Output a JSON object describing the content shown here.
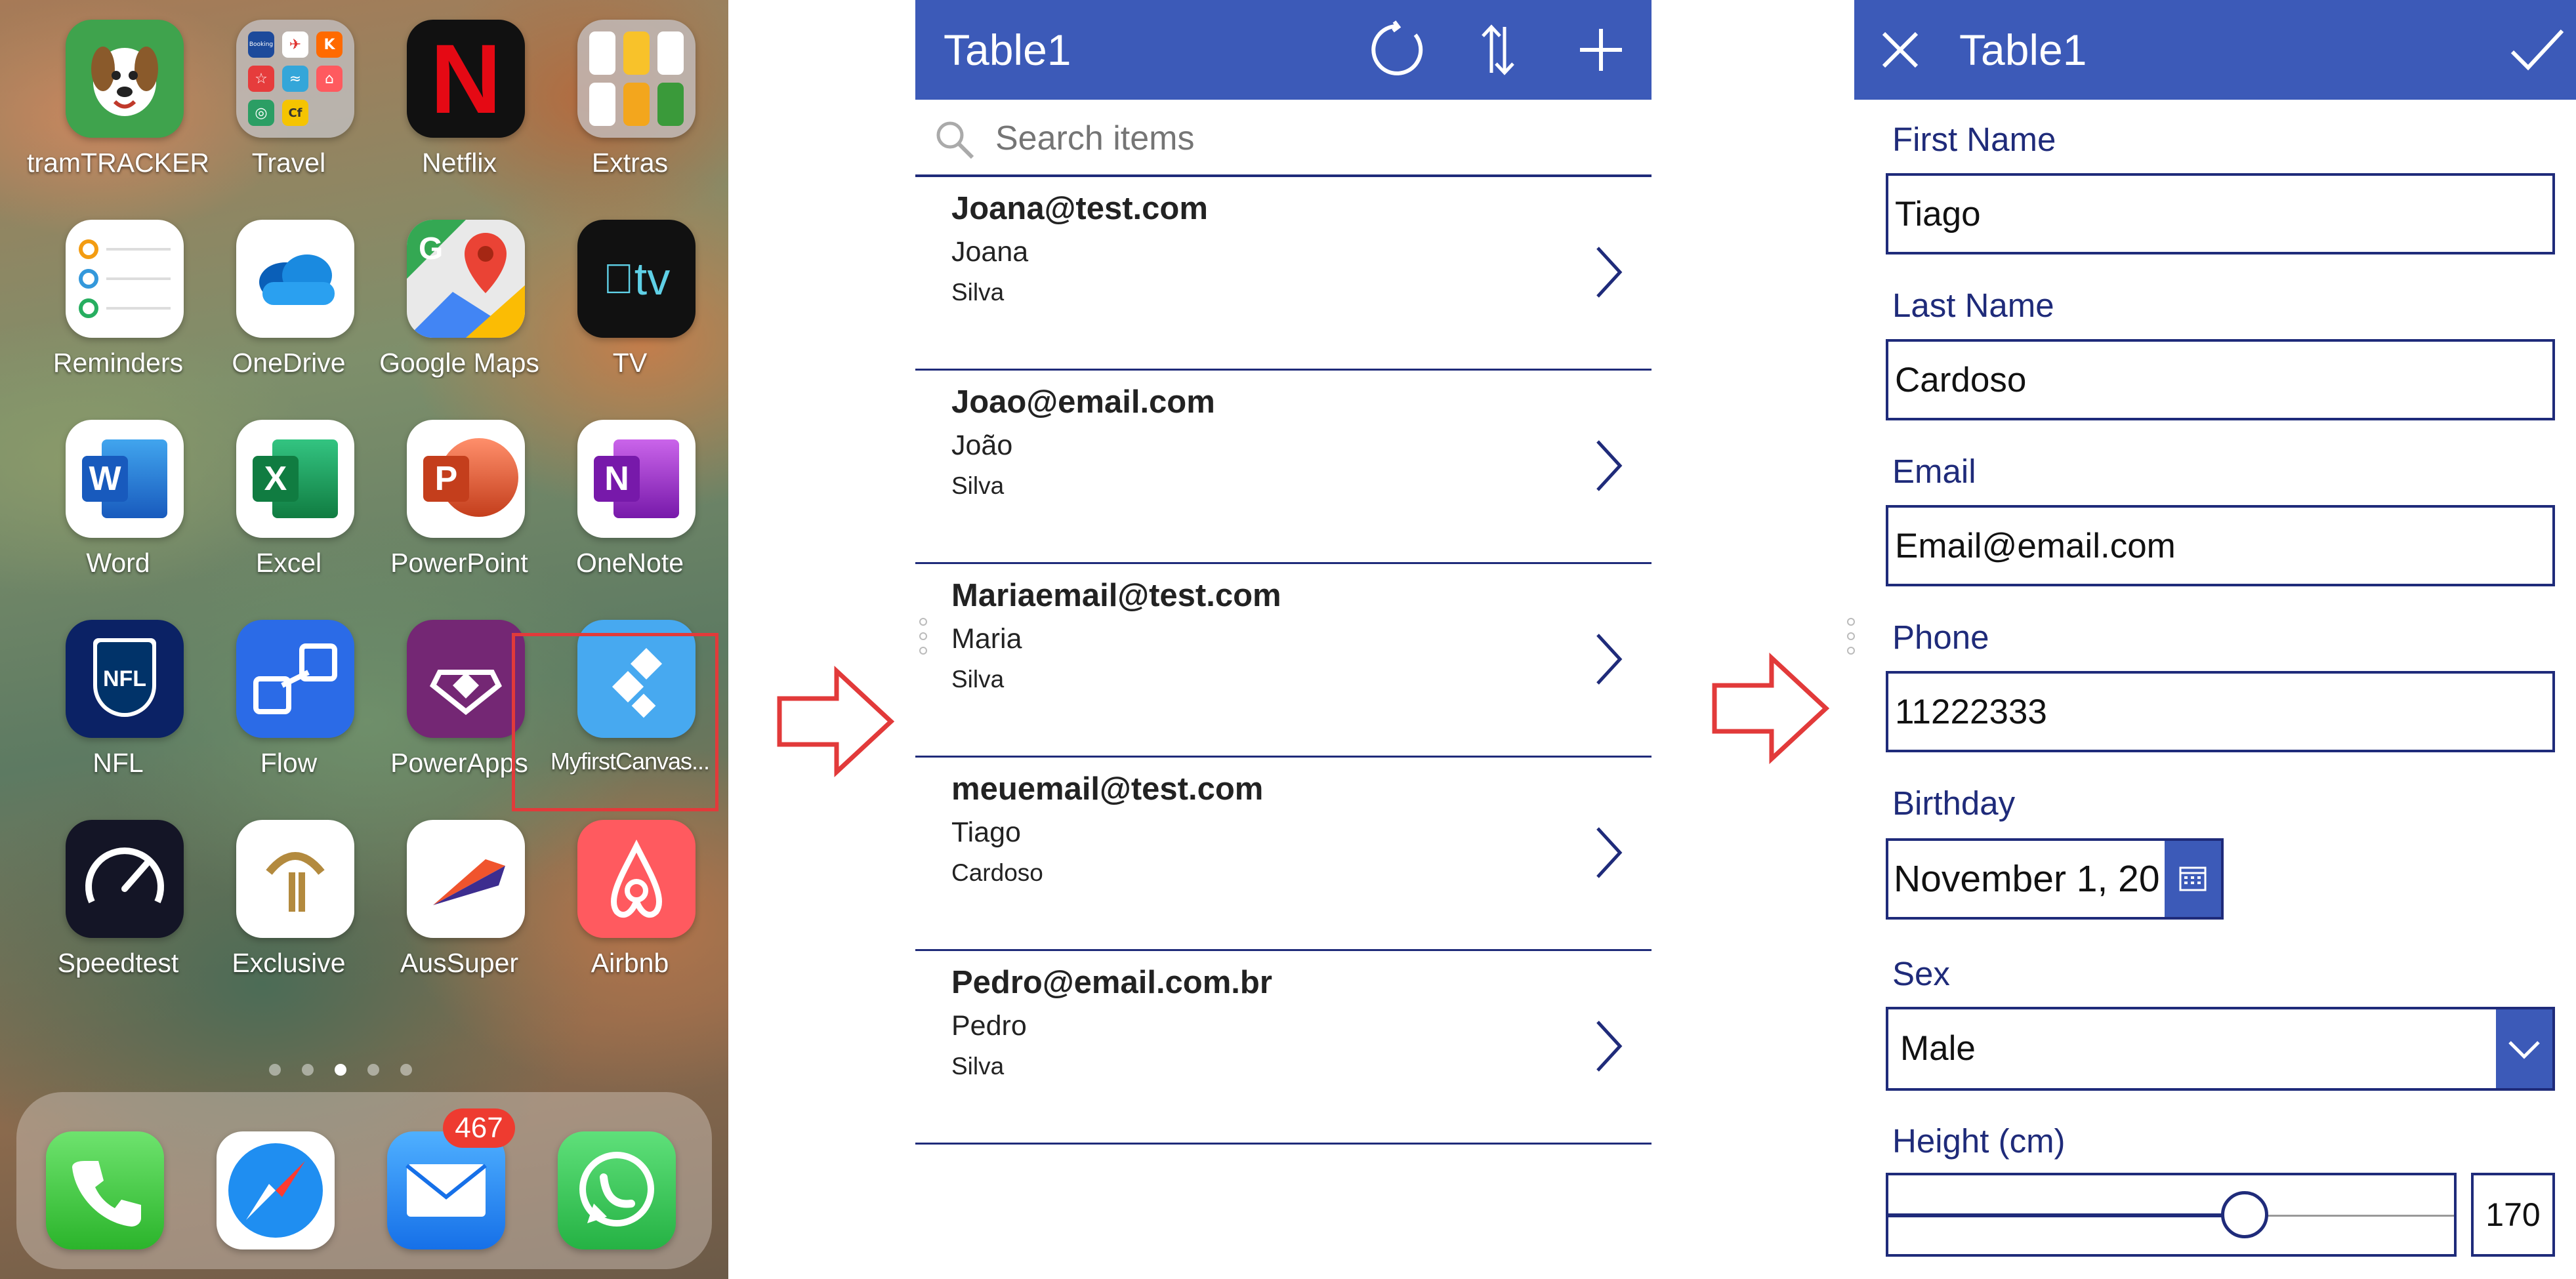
{
  "home_screen": {
    "apps": [
      {
        "id": "tramtracker",
        "label": "tramTRACKER",
        "icon": "tramtracker-icon"
      },
      {
        "id": "travel",
        "label": "Travel",
        "icon": "folder-icon"
      },
      {
        "id": "netflix",
        "label": "Netflix",
        "icon": "netflix-icon"
      },
      {
        "id": "extras",
        "label": "Extras",
        "icon": "folder-icon"
      },
      {
        "id": "reminders",
        "label": "Reminders",
        "icon": "reminders-icon"
      },
      {
        "id": "onedrive",
        "label": "OneDrive",
        "icon": "cloud-icon"
      },
      {
        "id": "googlemaps",
        "label": "Google Maps",
        "icon": "map-pin-icon"
      },
      {
        "id": "tv",
        "label": "TV",
        "icon": "apple-tv-icon"
      },
      {
        "id": "word",
        "label": "Word",
        "icon": "word-icon"
      },
      {
        "id": "excel",
        "label": "Excel",
        "icon": "excel-icon"
      },
      {
        "id": "powerpoint",
        "label": "PowerPoint",
        "icon": "powerpoint-icon"
      },
      {
        "id": "onenote",
        "label": "OneNote",
        "icon": "onenote-icon"
      },
      {
        "id": "nfl",
        "label": "NFL",
        "icon": "nfl-icon"
      },
      {
        "id": "flow",
        "label": "Flow",
        "icon": "flow-icon"
      },
      {
        "id": "powerapps",
        "label": "PowerApps",
        "icon": "powerapps-icon"
      },
      {
        "id": "myfirstcanvas",
        "label": "MyfirstCanvas...",
        "icon": "canvas-app-icon"
      },
      {
        "id": "speedtest",
        "label": "Speedtest",
        "icon": "speedometer-icon"
      },
      {
        "id": "exclusive",
        "label": "Exclusive",
        "icon": "exclusive-icon"
      },
      {
        "id": "aussuper",
        "label": "AusSuper",
        "icon": "aussuper-icon"
      },
      {
        "id": "airbnb",
        "label": "Airbnb",
        "icon": "airbnb-icon"
      }
    ],
    "text_glyphs": {
      "netflix": "N",
      "tv": "tv",
      "word": "W",
      "excel": "X",
      "powerpoint": "P",
      "onenote": "N",
      "nfl": "NFL",
      "travel_minis": [
        "Booking",
        "✈",
        "K",
        "☆",
        "≈",
        "⌂",
        "◎",
        "Cf"
      ]
    },
    "page_dots": {
      "count": 5,
      "active": 2
    },
    "dock": [
      {
        "id": "phone",
        "icon": "phone-icon"
      },
      {
        "id": "safari",
        "icon": "compass-icon"
      },
      {
        "id": "mail",
        "icon": "mail-icon"
      },
      {
        "id": "whatsapp",
        "icon": "whatsapp-icon"
      }
    ],
    "mail_badge": "467"
  },
  "browse_screen": {
    "title": "Table1",
    "search_placeholder": "Search items",
    "items": [
      {
        "email": "Joana@test.com",
        "first": "Joana",
        "last": "Silva"
      },
      {
        "email": "Joao@email.com",
        "first": "João",
        "last": "Silva"
      },
      {
        "email": "Mariaemail@test.com",
        "first": "Maria",
        "last": "Silva"
      },
      {
        "email": "meuemail@test.com",
        "first": "Tiago",
        "last": "Cardoso"
      },
      {
        "email": "Pedro@email.com.br",
        "first": "Pedro",
        "last": "Silva"
      }
    ]
  },
  "edit_screen": {
    "title": "Table1",
    "fields": {
      "first_name": {
        "label": "First Name",
        "value": "Tiago"
      },
      "last_name": {
        "label": "Last Name",
        "value": "Cardoso"
      },
      "email": {
        "label": "Email",
        "value": "Email@email.com"
      },
      "phone": {
        "label": "Phone",
        "value": "11222333"
      },
      "birthday": {
        "label": "Birthday",
        "value": "November 1, 20"
      },
      "sex": {
        "label": "Sex",
        "value": "Male"
      },
      "height": {
        "label": "Height (cm)",
        "value": "170",
        "fraction": 0.63
      }
    }
  },
  "colors": {
    "accent": "#3c5ab8",
    "navy": "#1f2b7a",
    "highlight": "#e23a3a",
    "badge": "#ee3b30"
  }
}
